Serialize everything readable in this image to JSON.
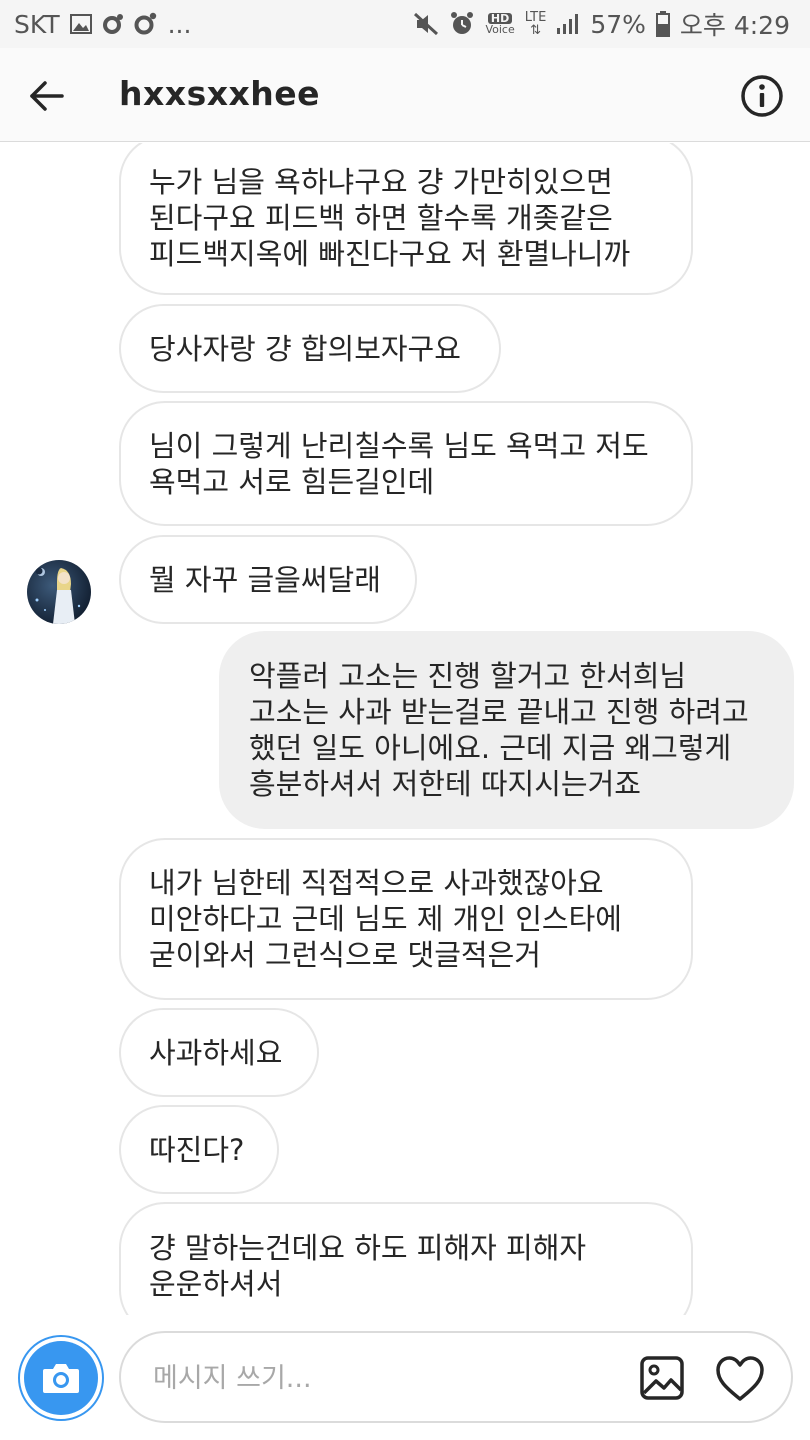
{
  "status_bar": {
    "carrier": "SKT",
    "more": "...",
    "hd_label": "HD",
    "voice_label": "Voice",
    "lte_label": "LTE",
    "battery": "57%",
    "time": "오후 4:29"
  },
  "header": {
    "username": "hxxsxxhee",
    "back_icon": "arrow-left-icon",
    "info_icon": "info-icon"
  },
  "messages": [
    {
      "direction": "received",
      "text": "누가 님을 욕하냐구요 걍 가만히있으면\n된다구요 피드백 하면 할수록 개좆같은\n피드백지옥에 빠진다구요 저 환멸나니까"
    },
    {
      "direction": "received",
      "text": "당사자랑 걍 합의보자구요"
    },
    {
      "direction": "received",
      "text": "님이 그렇게 난리칠수록 님도 욕먹고 저도\n욕먹고 서로 힘든길인데"
    },
    {
      "direction": "received",
      "text": "뭘 자꾸 글을써달래"
    },
    {
      "direction": "sent",
      "text": "악플러 고소는 진행 할거고 한서희님\n고소는 사과 받는걸로 끝내고 진행 하려고\n했던 일도 아니에요. 근데 지금 왜그렇게\n흥분하셔서 저한테 따지시는거죠"
    },
    {
      "direction": "received",
      "text": "내가 님한테 직접적으로 사과했잖아요\n미안하다고 근데 님도 제 개인 인스타에\n굳이와서 그런식으로 댓글적은거"
    },
    {
      "direction": "received",
      "text": "사과하세요"
    },
    {
      "direction": "received",
      "text": "따진다?"
    },
    {
      "direction": "received",
      "text": "걍 말하는건데요 하도 피해자 피해자\n운운하셔서"
    }
  ],
  "composer": {
    "placeholder": "메시지 쓰기...",
    "value": "",
    "camera_icon": "camera-icon",
    "gallery_icon": "image-icon",
    "heart_icon": "heart-icon"
  },
  "colors": {
    "accent": "#3897f0",
    "sent_bubble": "#efefef",
    "received_border": "#e6e6e6",
    "text": "#262626",
    "status_bar_bg": "#f5f5f5"
  }
}
